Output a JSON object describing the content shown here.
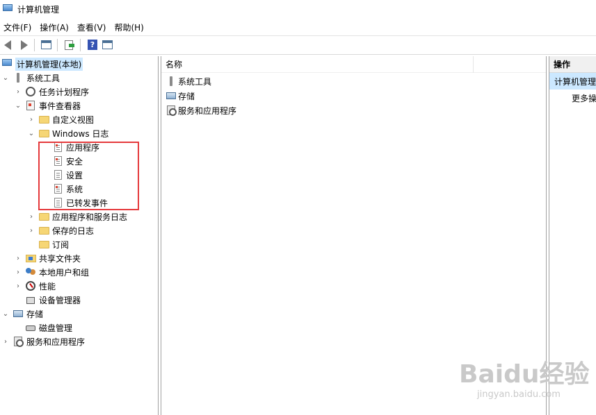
{
  "window": {
    "title": "计算机管理"
  },
  "menu": [
    {
      "label": "文件(F)"
    },
    {
      "label": "操作(A)"
    },
    {
      "label": "查看(V)"
    },
    {
      "label": "帮助(H)"
    }
  ],
  "toolbar": {
    "back_icon": "arrow-left-icon",
    "forward_icon": "arrow-right-icon",
    "show_hide_tree_icon": "console-tree-icon",
    "export_icon": "export-list-icon",
    "help_icon": "help-icon",
    "help_glyph": "?",
    "action_pane_icon": "action-pane-icon"
  },
  "tree": {
    "root": "计算机管理(本地)",
    "system_tools": "系统工具",
    "task_scheduler": "任务计划程序",
    "event_viewer": "事件查看器",
    "custom_views": "自定义视图",
    "windows_logs": "Windows 日志",
    "windows_logs_children": [
      "应用程序",
      "安全",
      "设置",
      "系统",
      "已转发事件"
    ],
    "apps_services_logs": "应用程序和服务日志",
    "saved_logs": "保存的日志",
    "subscriptions": "订阅",
    "shared_folders": "共享文件夹",
    "local_users_groups": "本地用户和组",
    "performance": "性能",
    "device_manager": "设备管理器",
    "storage": "存储",
    "disk_management": "磁盘管理",
    "services_apps": "服务和应用程序"
  },
  "middle": {
    "column_header": "名称",
    "items": [
      "系统工具",
      "存储",
      "服务和应用程序"
    ]
  },
  "actions": {
    "header": "操作",
    "selected": "计算机管理",
    "more": "更多操"
  },
  "watermark": {
    "main": "Baidu经验",
    "sub": "jingyan.baidu.com"
  },
  "colors": {
    "selection": "#cce8ff",
    "highlight_box": "#e5383b"
  }
}
